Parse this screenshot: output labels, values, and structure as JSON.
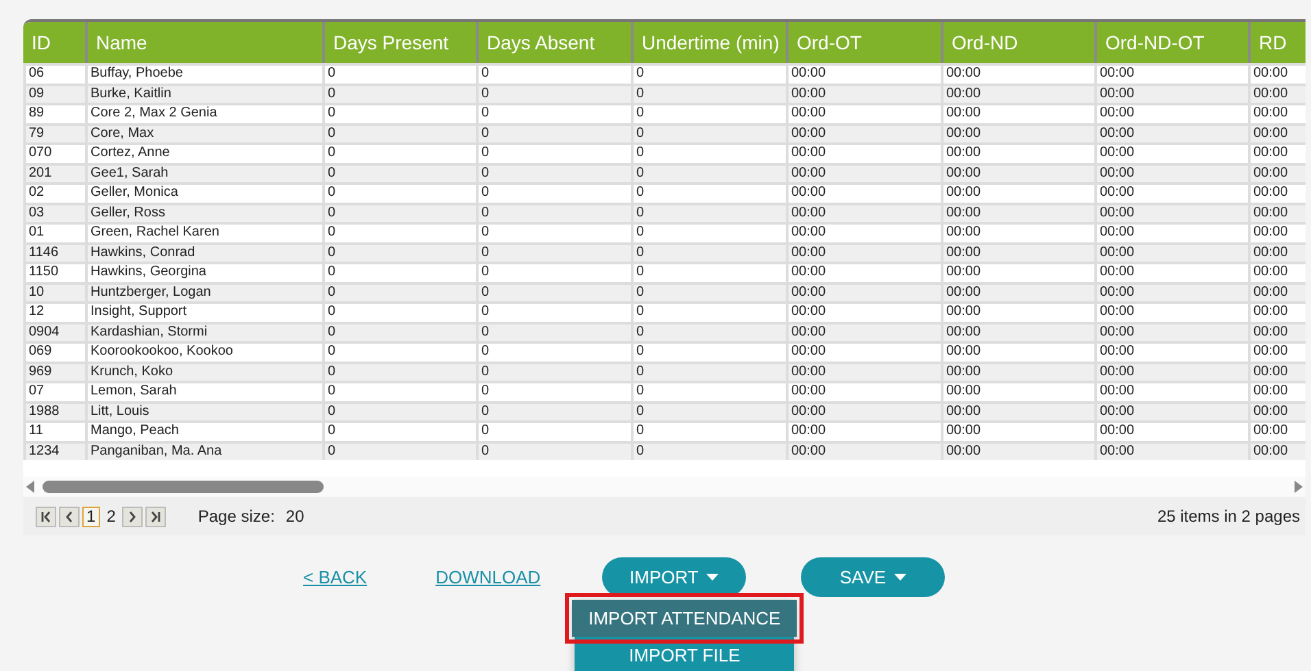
{
  "table": {
    "columns": [
      "ID",
      "Name",
      "Days Present",
      "Days Absent",
      "Undertime (min)",
      "Ord-OT",
      "Ord-ND",
      "Ord-ND-OT",
      "RD"
    ],
    "rows": [
      {
        "cells": [
          "06",
          "Buffay, Phoebe",
          "0",
          "0",
          "0",
          "00:00",
          "00:00",
          "00:00",
          "00:00"
        ]
      },
      {
        "cells": [
          "09",
          "Burke, Kaitlin",
          "0",
          "0",
          "0",
          "00:00",
          "00:00",
          "00:00",
          "00:00"
        ]
      },
      {
        "cells": [
          "89",
          "Core 2, Max 2 Genia",
          "0",
          "0",
          "0",
          "00:00",
          "00:00",
          "00:00",
          "00:00"
        ]
      },
      {
        "cells": [
          "79",
          "Core, Max",
          "0",
          "0",
          "0",
          "00:00",
          "00:00",
          "00:00",
          "00:00"
        ]
      },
      {
        "cells": [
          "070",
          "Cortez, Anne",
          "0",
          "0",
          "0",
          "00:00",
          "00:00",
          "00:00",
          "00:00"
        ]
      },
      {
        "cells": [
          "201",
          "Gee1, Sarah",
          "0",
          "0",
          "0",
          "00:00",
          "00:00",
          "00:00",
          "00:00"
        ]
      },
      {
        "cells": [
          "02",
          "Geller, Monica",
          "0",
          "0",
          "0",
          "00:00",
          "00:00",
          "00:00",
          "00:00"
        ]
      },
      {
        "cells": [
          "03",
          "Geller, Ross",
          "0",
          "0",
          "0",
          "00:00",
          "00:00",
          "00:00",
          "00:00"
        ]
      },
      {
        "cells": [
          "01",
          "Green, Rachel Karen",
          "0",
          "0",
          "0",
          "00:00",
          "00:00",
          "00:00",
          "00:00"
        ]
      },
      {
        "cells": [
          "1146",
          "Hawkins, Conrad",
          "0",
          "0",
          "0",
          "00:00",
          "00:00",
          "00:00",
          "00:00"
        ]
      },
      {
        "cells": [
          "1150",
          "Hawkins, Georgina",
          "0",
          "0",
          "0",
          "00:00",
          "00:00",
          "00:00",
          "00:00"
        ]
      },
      {
        "cells": [
          "10",
          "Huntzberger, Logan",
          "0",
          "0",
          "0",
          "00:00",
          "00:00",
          "00:00",
          "00:00"
        ]
      },
      {
        "cells": [
          "12",
          "Insight, Support",
          "0",
          "0",
          "0",
          "00:00",
          "00:00",
          "00:00",
          "00:00"
        ]
      },
      {
        "cells": [
          "0904",
          "Kardashian, Stormi",
          "0",
          "0",
          "0",
          "00:00",
          "00:00",
          "00:00",
          "00:00"
        ]
      },
      {
        "cells": [
          "069",
          "Koorookookoo, Kookoo",
          "0",
          "0",
          "0",
          "00:00",
          "00:00",
          "00:00",
          "00:00"
        ]
      },
      {
        "cells": [
          "969",
          "Krunch, Koko",
          "0",
          "0",
          "0",
          "00:00",
          "00:00",
          "00:00",
          "00:00"
        ]
      },
      {
        "cells": [
          "07",
          "Lemon, Sarah",
          "0",
          "0",
          "0",
          "00:00",
          "00:00",
          "00:00",
          "00:00"
        ]
      },
      {
        "cells": [
          "1988",
          "Litt, Louis",
          "0",
          "0",
          "0",
          "00:00",
          "00:00",
          "00:00",
          "00:00"
        ]
      },
      {
        "cells": [
          "11",
          "Mango, Peach",
          "0",
          "0",
          "0",
          "00:00",
          "00:00",
          "00:00",
          "00:00"
        ]
      },
      {
        "cells": [
          "1234",
          "Panganiban, Ma. Ana",
          "0",
          "0",
          "0",
          "00:00",
          "00:00",
          "00:00",
          "00:00"
        ]
      }
    ]
  },
  "pager": {
    "pages": [
      {
        "label": "1",
        "selected": true
      },
      {
        "label": "2",
        "selected": false
      }
    ],
    "page_size_label": "Page size:",
    "page_size": "20",
    "summary": "25 items in 2 pages"
  },
  "actions": {
    "back": "< BACK",
    "download": "DOWNLOAD",
    "import": "IMPORT",
    "save": "SAVE"
  },
  "import_menu": [
    {
      "label": "IMPORT ATTENDANCE",
      "selected": true
    },
    {
      "label": "IMPORT FILE",
      "selected": false
    }
  ]
}
